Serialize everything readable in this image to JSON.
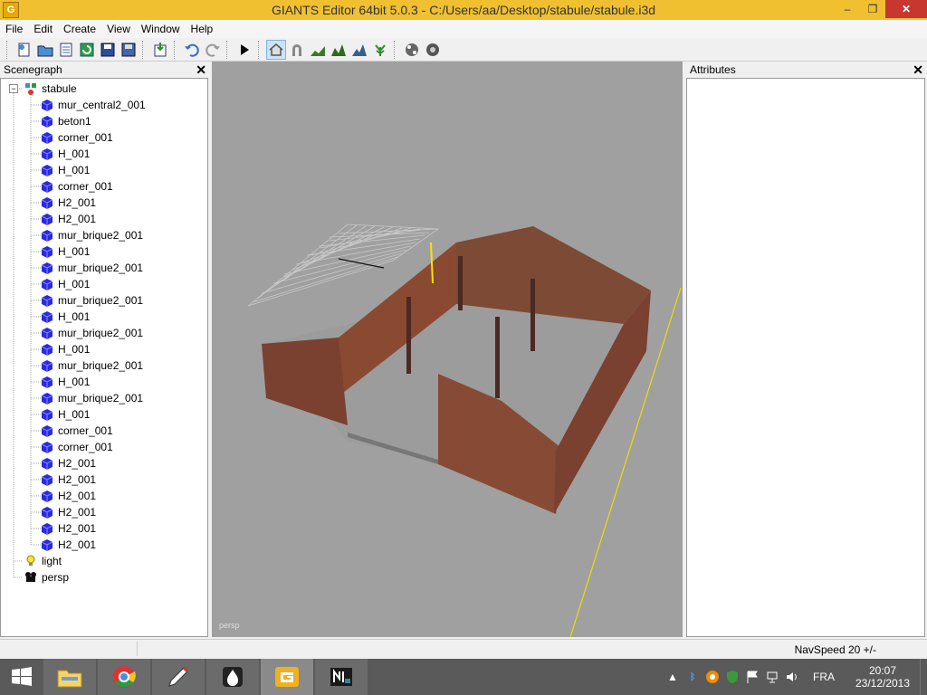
{
  "window": {
    "title": "GIANTS Editor 64bit 5.0.3 - C:/Users/aa/Desktop/stabule/stabule.i3d",
    "app_icon_letter": "G",
    "minimize": "–",
    "maximize": "❐",
    "close": "✕"
  },
  "menu": {
    "items": [
      {
        "label": "File"
      },
      {
        "label": "Edit"
      },
      {
        "label": "Create"
      },
      {
        "label": "View"
      },
      {
        "label": "Window"
      },
      {
        "label": "Help"
      }
    ]
  },
  "scenegraph": {
    "title": "Scenegraph",
    "close": "✕",
    "root": "stabule",
    "children": [
      "mur_central2_001",
      "beton1",
      "corner_001",
      "H_001",
      "H_001",
      "corner_001",
      "H2_001",
      "H2_001",
      "mur_brique2_001",
      "H_001",
      "mur_brique2_001",
      "H_001",
      "mur_brique2_001",
      "H_001",
      "mur_brique2_001",
      "H_001",
      "mur_brique2_001",
      "H_001",
      "mur_brique2_001",
      "H_001",
      "corner_001",
      "corner_001",
      "H2_001",
      "H2_001",
      "H2_001",
      "H2_001",
      "H2_001",
      "H2_001"
    ],
    "light": "light",
    "camera": "persp",
    "collapse_glyph": "−"
  },
  "viewport": {
    "label": "persp"
  },
  "attributes": {
    "title": "Attributes",
    "close": "✕"
  },
  "status": {
    "navspeed": "NavSpeed 20 +/-"
  },
  "taskbar": {
    "lang": "FRA",
    "time": "20:07",
    "date": "23/12/2013"
  },
  "colors": {
    "titlebar": "#f0c030",
    "close_btn": "#c7372f",
    "cube_blue": "#2a2ae0",
    "viewport_bg": "#a0a0a0",
    "brick": "#8a4a32",
    "floor": "#9a9a9a",
    "taskbar": "#5a5a5a"
  }
}
